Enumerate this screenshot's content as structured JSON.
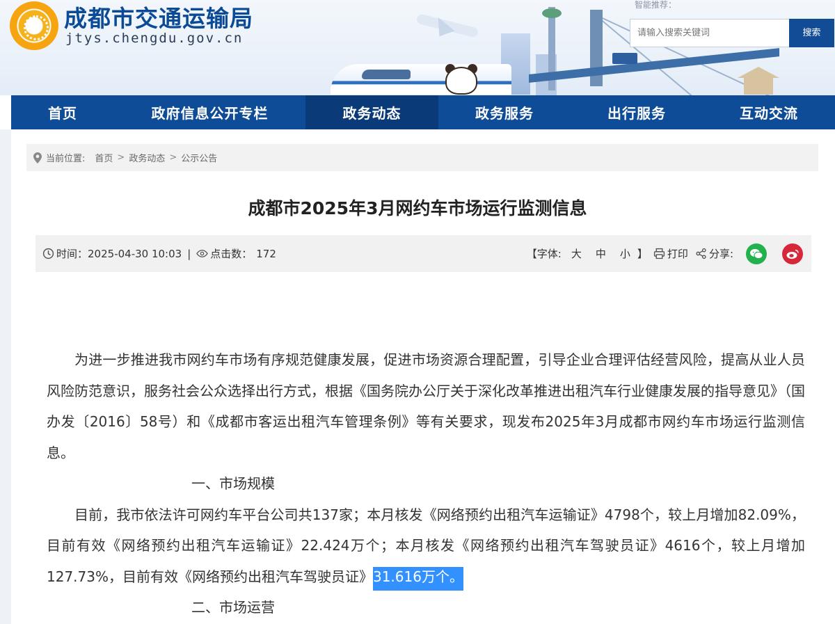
{
  "header": {
    "site_name": "成都市交通运输局",
    "site_domain": "jtys.chengdu.gov.cn",
    "search_label": "智能推荐：",
    "search_placeholder": "请输入搜索关键词",
    "search_button": "搜索"
  },
  "nav": {
    "items": [
      {
        "label": "首页"
      },
      {
        "label": "政府信息公开专栏"
      },
      {
        "label": "政务动态",
        "active": true
      },
      {
        "label": "政务服务"
      },
      {
        "label": "出行服务"
      },
      {
        "label": "互动交流"
      }
    ]
  },
  "breadcrumb": {
    "prefix": "当前位置:",
    "items": [
      "首页",
      "政务动态",
      "公示公告"
    ],
    "separator": ">"
  },
  "article": {
    "title": "成都市2025年3月网约车市场运行监测信息",
    "meta": {
      "time_label": "时间：",
      "time_value": "2025-04-30 10:03",
      "divider": "|",
      "clicks_label": "点击数：",
      "clicks_value": "172",
      "font_open": "【字体:",
      "font_large": "大",
      "font_medium": "中",
      "font_small": "小",
      "font_close": "】",
      "print": "打印",
      "share": "分享:"
    },
    "intro": "为进一步推进我市网约车市场有序规范健康发展，促进市场资源合理配置，引导企业合理评估经营风险，提高从业人员风险防范意识，服务社会公众选择出行方式，根据《国务院办公厅关于深化改革推进出租汽车行业健康发展的指导意见》（国办发〔2016〕58号）和《成都市客运出租汽车管理条例》等有关要求，现发布2025年3月成都市网约车市场运行监测信息。",
    "section1_heading": "一、市场规模",
    "section1_text": "目前，我市依法许可网约车平台公司共137家；本月核发《网络预约出租汽车运输证》4798个，较上月增加82.09%，目前有效《网络预约出租汽车运输证》22.424万个；本月核发《网络预约出租汽车驾驶员证》4616个，较上月增加127.73%，目前有效《网络预约出租汽车驾驶员证》",
    "section1_highlight": "31.616万个。",
    "section2_heading": "二、市场运营"
  },
  "colors": {
    "nav_bg": "#0f4c97",
    "nav_active": "#0a3a78",
    "brand_blue": "#0a4a96",
    "highlight": "#3391ff",
    "wechat": "#22b14c",
    "weibo": "#d6283a"
  }
}
